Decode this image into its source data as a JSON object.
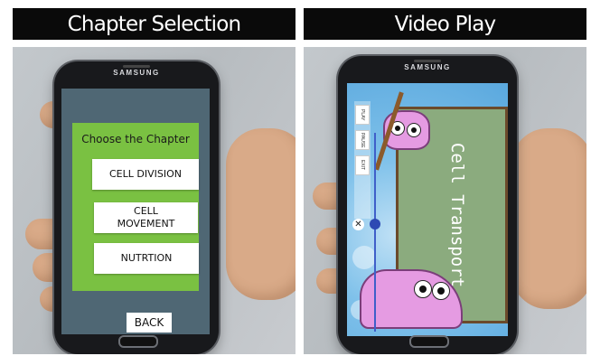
{
  "panels": {
    "left": {
      "header": "Chapter Selection",
      "phone_brand": "SAMSUNG",
      "screen": {
        "prompt": "Choose the Chapter",
        "buttons": [
          "CELL DIVISION",
          "CELL MOVEMENT",
          "NUTRTION"
        ],
        "back_label": "BACK"
      }
    },
    "right": {
      "header": "Video Play",
      "phone_brand": "SAMSUNG",
      "screen": {
        "board_text": "Cell Transport",
        "controls": [
          "PLAY",
          "PAUSE",
          "EXIT"
        ],
        "close_icon": "close-icon"
      }
    }
  },
  "colors": {
    "header_bg": "#0a0a0a",
    "card_green": "#7ac142",
    "screen_bg": "#4f6774",
    "board_green": "#8bab7e",
    "monster_pink": "#e59be2"
  }
}
